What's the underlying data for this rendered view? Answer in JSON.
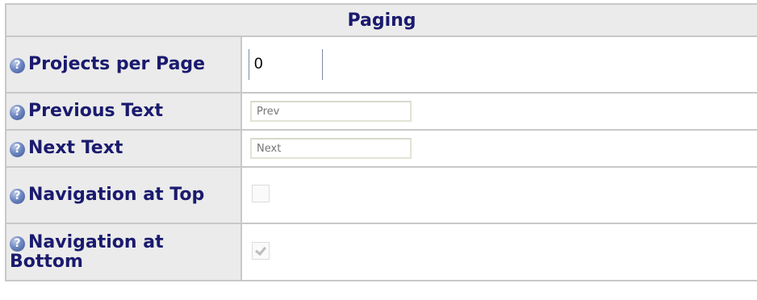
{
  "section": {
    "title": "Paging"
  },
  "rows": [
    {
      "label": "Projects per Page",
      "type": "number",
      "value": "0"
    },
    {
      "label": "Previous Text",
      "type": "text",
      "value": "",
      "placeholder": "Prev"
    },
    {
      "label": "Next Text",
      "type": "text",
      "value": "",
      "placeholder": "Next"
    },
    {
      "label": "Navigation at Top",
      "type": "checkbox",
      "checked": false
    },
    {
      "label": "Navigation at Bottom",
      "type": "checkbox",
      "checked": true
    }
  ],
  "icons": {
    "help": "help-icon"
  },
  "colors": {
    "label_text": "#1a1a6e",
    "label_bg": "#ebebeb",
    "border": "#c8c8c8",
    "help_icon": "#4a66a8"
  }
}
